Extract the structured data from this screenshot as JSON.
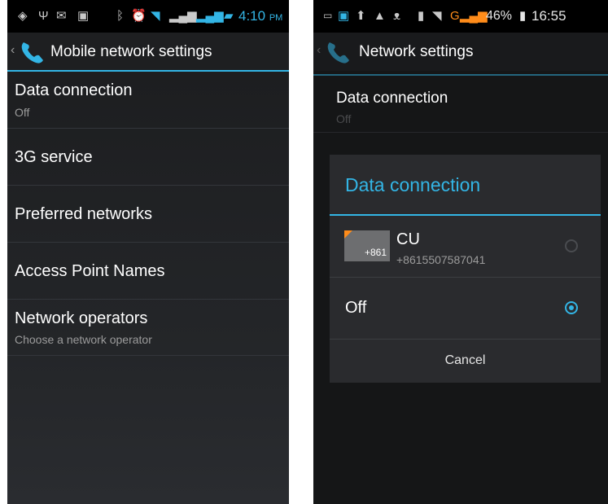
{
  "left": {
    "status": {
      "time": "4:10",
      "ampm": "PM"
    },
    "actionbar": {
      "title": "Mobile network settings"
    },
    "items": [
      {
        "title": "Data connection",
        "subtitle": "Off"
      },
      {
        "title": "3G service",
        "subtitle": ""
      },
      {
        "title": "Preferred networks",
        "subtitle": ""
      },
      {
        "title": "Access Point Names",
        "subtitle": ""
      },
      {
        "title": "Network operators",
        "subtitle": "Choose a network operator"
      }
    ]
  },
  "right": {
    "status": {
      "network": "G",
      "battery": "46%",
      "time": "16:55"
    },
    "actionbar": {
      "title": "Network settings"
    },
    "background_item": {
      "title": "Data connection",
      "subtitle": "Off"
    },
    "dialog": {
      "title": "Data connection",
      "options": [
        {
          "name": "CU",
          "number": "+8615507587041",
          "sim_label": "+861",
          "selected": false
        },
        {
          "name": "Off",
          "selected": true
        }
      ],
      "cancel_label": "Cancel"
    }
  },
  "colors": {
    "accent": "#33b5e5",
    "background": "#1c1c1e",
    "sim_corner": "#ff8c1a"
  }
}
